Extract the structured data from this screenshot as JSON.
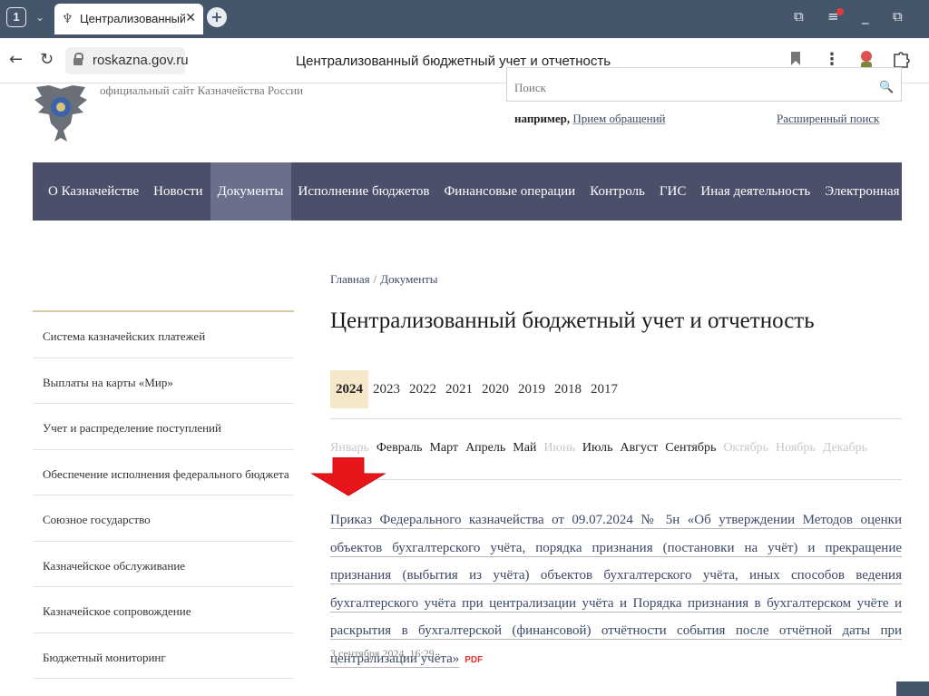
{
  "browser": {
    "tab_count": "1",
    "tab_title": "Централизованный бюджетный учет и отчетность",
    "url": "roskazna.gov.ru",
    "page_title": "Централизованный бюджетный учет и отчетность",
    "icons": {
      "back": "←",
      "reload": "↻",
      "tab_close": "✕",
      "new_tab": "+",
      "dropdown": "⌄",
      "minimize": "_",
      "restore": "⧉",
      "more": "⋮",
      "tab_favicon": "♆",
      "tab_list": "⧉",
      "downloads": "≡"
    },
    "colors": {
      "chrome": "#45566b",
      "notification": "#e23a3a"
    }
  },
  "site": {
    "tagline": "официальный сайт Казначейства России",
    "search": {
      "placeholder": "Поиск",
      "button_icon": "🔍",
      "hint_label": "например,",
      "hint_link": "Прием обращений",
      "advanced": "Расширенный поиск"
    },
    "nav": [
      {
        "label": "О Казначействе",
        "active": false
      },
      {
        "label": "Новости",
        "active": false
      },
      {
        "label": "Документы",
        "active": true
      },
      {
        "label": "Исполнение бюджетов",
        "active": false
      },
      {
        "label": "Финансовые операции",
        "active": false
      },
      {
        "label": "Контроль",
        "active": false
      },
      {
        "label": "ГИС",
        "active": false
      },
      {
        "label": "Иная деятельность",
        "active": false
      },
      {
        "label": "Электронная приемная",
        "active": false
      }
    ],
    "nav_color": "#4b4f69"
  },
  "sidebar": {
    "items": [
      {
        "label": "Система казначейских платежей"
      },
      {
        "label": "Выплаты на карты «Мир»"
      },
      {
        "label": "Учет и распределение поступлений"
      },
      {
        "label": "Обеспечение исполнения федерального бюджета"
      },
      {
        "label": "Союзное государство"
      },
      {
        "label": "Казначейское обслуживание"
      },
      {
        "label": "Казначейское сопровождение"
      },
      {
        "label": "Бюджетный мониторинг"
      }
    ]
  },
  "content": {
    "breadcrumb": {
      "home": "Главная",
      "separator": "/",
      "current": "Документы"
    },
    "title": "Централизованный бюджетный учет и отчетность",
    "years": [
      {
        "label": "2024",
        "active": true
      },
      {
        "label": "2023",
        "active": false
      },
      {
        "label": "2022",
        "active": false
      },
      {
        "label": "2021",
        "active": false
      },
      {
        "label": "2020",
        "active": false
      },
      {
        "label": "2019",
        "active": false
      },
      {
        "label": "2018",
        "active": false
      },
      {
        "label": "2017",
        "active": false
      }
    ],
    "months": [
      {
        "label": "Январь",
        "enabled": false
      },
      {
        "label": "Февраль",
        "enabled": true
      },
      {
        "label": "Март",
        "enabled": true
      },
      {
        "label": "Апрель",
        "enabled": true
      },
      {
        "label": "Май",
        "enabled": true
      },
      {
        "label": "Июнь",
        "enabled": false
      },
      {
        "label": "Июль",
        "enabled": true
      },
      {
        "label": "Август",
        "enabled": true
      },
      {
        "label": "Сентябрь",
        "enabled": true
      },
      {
        "label": "Октябрь",
        "enabled": false
      },
      {
        "label": "Ноябрь",
        "enabled": false
      },
      {
        "label": "Декабрь",
        "enabled": false
      }
    ],
    "document": {
      "title": "Приказ Федерального казначейства от 09.07.2024 № 5н «Об утверждении Методов оценки объектов бухгалтерского учёта, порядка признания (постановки на учёт) и прекращение признания (выбытия из учёта) объектов бухгалтерского учёта, иных способов ведения бухгалтерского учёта при централизации учёта и Порядка признания в бухгалтерском учёте и раскрытия в бухгалтерской (финансовой) отчётности события после отчётной даты при централизации учёта»",
      "format": "PDF",
      "date": "3 сентября 2024, 16:29"
    },
    "annotation_arrow_color": "#e8161a"
  }
}
